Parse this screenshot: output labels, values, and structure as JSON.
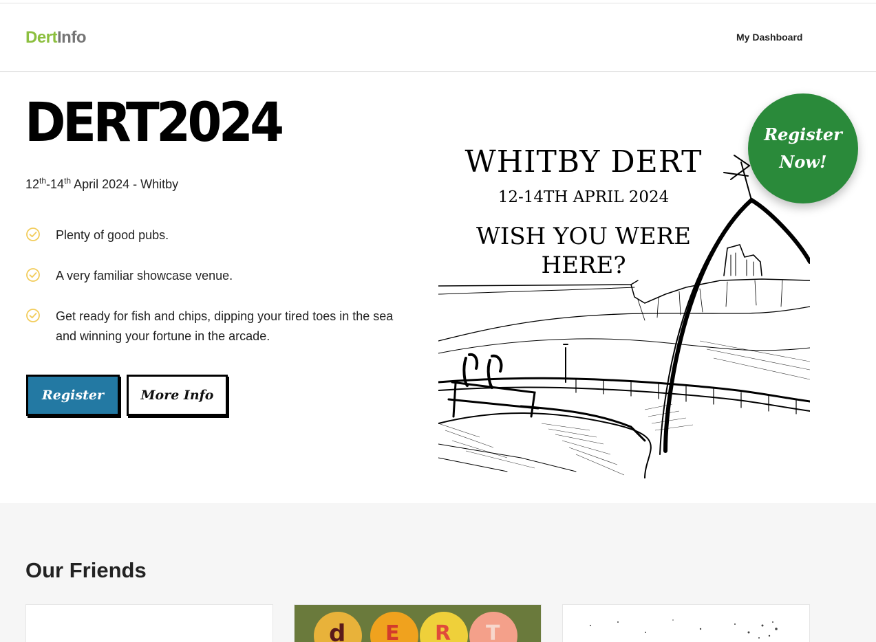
{
  "header": {
    "logo_part1": "Dert",
    "logo_part2": "Info",
    "nav_dashboard": "My Dashboard"
  },
  "hero": {
    "title": "DERT2024",
    "date_start": "12",
    "date_start_suffix": "th",
    "date_sep": "-14",
    "date_end_suffix": "th",
    "date_rest": " April 2024 - Whitby",
    "features": [
      "Plenty of good pubs.",
      "A very familiar showcase venue.",
      "Get ready for fish and chips, dipping your tired toes in the sea and winning your fortune in the arcade."
    ],
    "register_label": "Register",
    "more_info_label": "More Info"
  },
  "poster": {
    "line1": "WHITBY DERT",
    "line2": "12-14TH APRIL 2024",
    "line3": "WISH YOU WERE",
    "line4": "HERE?"
  },
  "badge": {
    "line1": "Register",
    "line2": "Now!"
  },
  "friends": {
    "heading": "Our Friends",
    "card_letters": [
      "d",
      "E",
      "R",
      "T"
    ]
  },
  "colors": {
    "logo_green": "#8cbf3f",
    "logo_gray": "#757575",
    "register_blue": "#2379a3",
    "badge_green": "#2a8a3a",
    "check_yellow": "#f2cc5a"
  },
  "icons": {
    "feature_icon": "check-circle-icon"
  }
}
